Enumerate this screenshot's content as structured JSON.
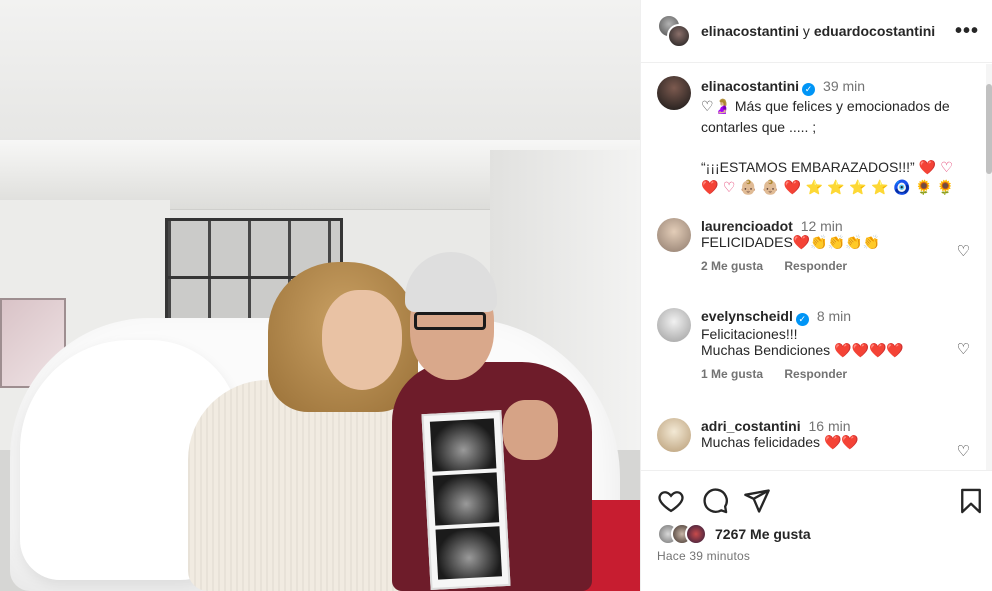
{
  "header": {
    "user1": "elinacostantini",
    "conj": "y",
    "user2": "eduardocostantini",
    "more_icon": "•••"
  },
  "caption": {
    "username": "elinacostantini",
    "time": "39 min",
    "line1_emojis": "♡🤰🏼",
    "line1_text": "Más que felices y emocionados de contarles que ..... ;",
    "line2_text": "“¡¡¡ESTAMOS EMBARAZADOS!!!”",
    "line2_emojis": "❤️ ♡",
    "line3_emojis": "❤️ ♡ 👶🏼 👶🏼 ❤️ ⭐ ⭐ ⭐ ⭐ 🧿 🌻 🌻"
  },
  "comments": [
    {
      "username": "laurencioadot",
      "time": "12 min",
      "text": "FELICIDADES",
      "emojis": "❤️👏👏👏👏",
      "likes": "2 Me gusta",
      "reply": "Responder",
      "verified": false
    },
    {
      "username": "evelynscheidl",
      "time": "8 min",
      "text": "Felicitaciones!!!",
      "text2": "Muchas Bendiciones",
      "emojis": "❤️❤️❤️❤️",
      "likes": "1 Me gusta",
      "reply": "Responder",
      "verified": true
    },
    {
      "username": "adri_costantini",
      "time": "16 min",
      "text": "Muchas felicidades",
      "emojis": "❤️❤️",
      "verified": false
    }
  ],
  "actions": {
    "like_icon": "heart-outline-icon",
    "comment_icon": "comment-icon",
    "share_icon": "share-icon",
    "save_icon": "bookmark-icon",
    "likes_count": "7267",
    "likes_label": "Me gusta",
    "time_ago": "Hace 39 minutos"
  },
  "colors": {
    "verified": "#0095f6",
    "muted_text": "#737373",
    "heart_red": "#e0245e"
  }
}
